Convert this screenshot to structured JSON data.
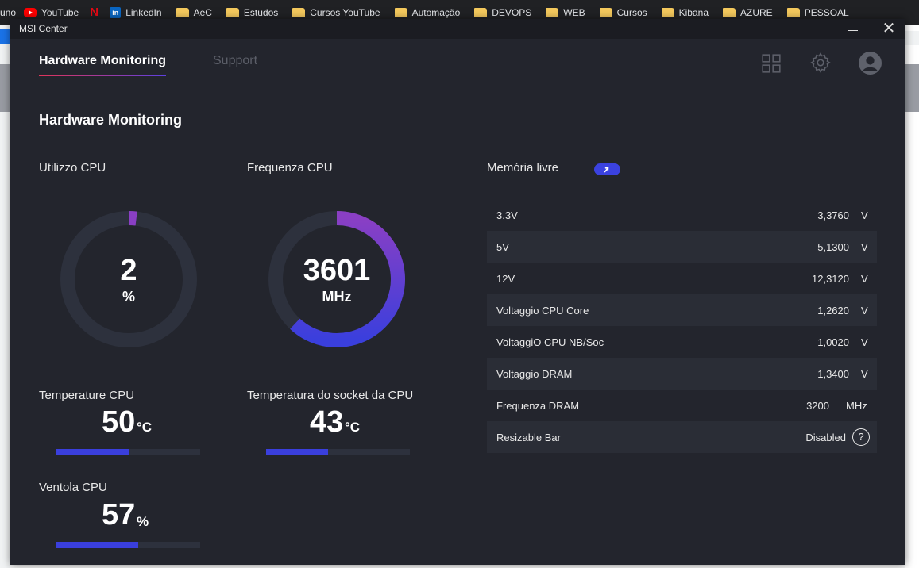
{
  "browser": {
    "bookmarks": [
      {
        "label": "uno",
        "icon": "none"
      },
      {
        "label": "YouTube",
        "icon": "youtube-icon"
      },
      {
        "label": "",
        "icon": "netflix-icon"
      },
      {
        "label": "LinkedIn",
        "icon": "linkedin-icon"
      },
      {
        "label": "AeC",
        "icon": "folder-icon"
      },
      {
        "label": "Estudos",
        "icon": "folder-icon"
      },
      {
        "label": "Cursos YouTube",
        "icon": "folder-icon"
      },
      {
        "label": "Automação",
        "icon": "folder-icon"
      },
      {
        "label": "DEVOPS",
        "icon": "folder-icon"
      },
      {
        "label": "WEB",
        "icon": "folder-icon"
      },
      {
        "label": "Cursos",
        "icon": "folder-icon"
      },
      {
        "label": "Kibana",
        "icon": "folder-icon"
      },
      {
        "label": "AZURE",
        "icon": "folder-icon"
      },
      {
        "label": "PESSOAL",
        "icon": "folder-icon"
      }
    ]
  },
  "window": {
    "title": "MSI Center"
  },
  "nav": {
    "tabs": [
      {
        "label": "Hardware Monitoring",
        "active": true
      },
      {
        "label": "Support",
        "active": false
      }
    ]
  },
  "page": {
    "title": "Hardware Monitoring"
  },
  "cpu_usage": {
    "label": "Utilizzo CPU",
    "value": "2",
    "unit": "%",
    "fraction": 0.02
  },
  "cpu_freq": {
    "label": "Frequenza CPU",
    "value": "3601",
    "unit": "MHz",
    "fraction": 0.62
  },
  "cpu_temp": {
    "label": "Temperature CPU",
    "value": "50",
    "unit": "°C",
    "fraction": 0.5
  },
  "socket_temp": {
    "label": "Temperatura do socket da CPU",
    "value": "43",
    "unit": "°C",
    "fraction": 0.43
  },
  "cpu_fan": {
    "label": "Ventola CPU",
    "value": "57",
    "unit": "%",
    "fraction": 0.57
  },
  "memory": {
    "label": "Memória livre",
    "rows": [
      {
        "name": "3.3V",
        "value": "3,3760",
        "unit": "V"
      },
      {
        "name": "5V",
        "value": "5,1300",
        "unit": "V"
      },
      {
        "name": "12V",
        "value": "12,3120",
        "unit": "V"
      },
      {
        "name": "Voltaggio CPU Core",
        "value": "1,2620",
        "unit": "V"
      },
      {
        "name": "VoltaggiO CPU NB/Soc",
        "value": "1,0020",
        "unit": "V"
      },
      {
        "name": "Voltaggio DRAM",
        "value": "1,3400",
        "unit": "V"
      },
      {
        "name": "Frequenza DRAM",
        "value": "3200",
        "unit": "MHz"
      },
      {
        "name": "Resizable Bar",
        "value": "Disabled",
        "unit": "?"
      }
    ]
  },
  "colors": {
    "accent": "#3a3fdd",
    "gauge_track": "#2d313d",
    "gauge_start": "#8a3fc4",
    "gauge_end": "#3a3fdd"
  }
}
